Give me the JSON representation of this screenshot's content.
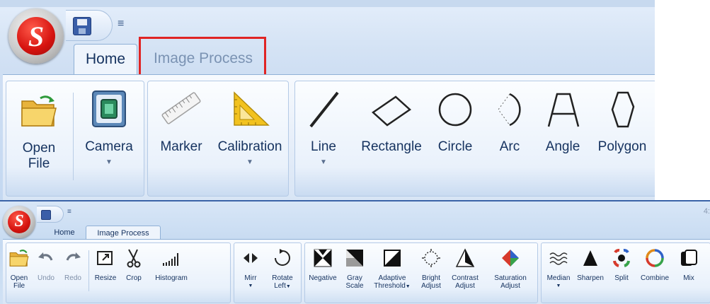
{
  "top_ribbon": {
    "tabs": [
      {
        "label": "Home",
        "active": true
      },
      {
        "label": "Image Process",
        "active": false
      }
    ],
    "groups": [
      {
        "buttons": [
          {
            "label_line1": "Open",
            "label_line2": "File",
            "icon": "open-folder-icon"
          },
          {
            "label_line1": "Camera",
            "dropdown": true,
            "icon": "camera-icon"
          }
        ]
      },
      {
        "buttons": [
          {
            "label_line1": "Marker",
            "icon": "ruler-icon"
          },
          {
            "label_line1": "Calibration",
            "dropdown": true,
            "icon": "set-square-icon"
          }
        ]
      },
      {
        "buttons": [
          {
            "label_line1": "Line",
            "dropdown": true,
            "icon": "line-icon"
          },
          {
            "label_line1": "Rectangle",
            "icon": "rectangle-icon"
          },
          {
            "label_line1": "Circle",
            "icon": "circle-icon"
          },
          {
            "label_line1": "Arc",
            "icon": "arc-icon"
          },
          {
            "label_line1": "Angle",
            "icon": "angle-icon"
          },
          {
            "label_line1": "Polygon",
            "icon": "polygon-icon"
          }
        ]
      }
    ],
    "qat_arrow": "≡",
    "app_logo_letter": "S"
  },
  "bottom_ribbon": {
    "tabs": [
      {
        "label": "Home",
        "active": false
      },
      {
        "label": "Image Process",
        "active": true
      }
    ],
    "corner_text": "4:",
    "app_logo_letter": "S",
    "qat_arrow": "≡",
    "groups": [
      {
        "buttons": [
          {
            "label_line1": "Open",
            "label_line2": "File",
            "icon": "open-folder-icon"
          },
          {
            "label_line1": "Undo",
            "icon": "undo-icon",
            "disabled": true
          },
          {
            "label_line1": "Redo",
            "icon": "redo-icon",
            "disabled": true
          },
          {
            "label_line1": "Resize",
            "icon": "resize-icon"
          },
          {
            "label_line1": "Crop",
            "icon": "scissors-icon"
          },
          {
            "label_line1": "Histogram",
            "icon": "histogram-icon"
          }
        ]
      },
      {
        "buttons": [
          {
            "label_line1": "Mirr",
            "dropdown": true,
            "icon": "mirror-icon"
          },
          {
            "label_line1": "Rotate",
            "label_line2": "Left",
            "dropdown": true,
            "icon": "rotate-left-icon"
          }
        ]
      },
      {
        "buttons": [
          {
            "label_line1": "Negative",
            "icon": "negative-icon"
          },
          {
            "label_line1": "Gray",
            "label_line2": "Scale",
            "icon": "grayscale-icon"
          },
          {
            "label_line1": "Adaptive",
            "label_line2": "Threshold",
            "dropdown": true,
            "icon": "threshold-icon"
          },
          {
            "label_line1": "Bright",
            "label_line2": "Adjust",
            "icon": "brightness-icon"
          },
          {
            "label_line1": "Contrast",
            "label_line2": "Adjust",
            "icon": "contrast-icon"
          },
          {
            "label_line1": "Saturation",
            "label_line2": "Adjust",
            "icon": "saturation-icon"
          }
        ]
      },
      {
        "buttons": [
          {
            "label_line1": "Median",
            "dropdown": true,
            "icon": "median-icon"
          },
          {
            "label_line1": "Sharpen",
            "icon": "sharpen-icon"
          },
          {
            "label_line1": "Split",
            "icon": "split-icon"
          },
          {
            "label_line1": "Combine",
            "icon": "combine-icon"
          },
          {
            "label_line1": "Mix",
            "icon": "mix-icon"
          }
        ]
      }
    ]
  },
  "colors": {
    "ribbon_blue": "#c4d8f1",
    "label_text": "#15325f",
    "highlight_red": "#e02424",
    "accent_blue": "#1f6bd1"
  }
}
